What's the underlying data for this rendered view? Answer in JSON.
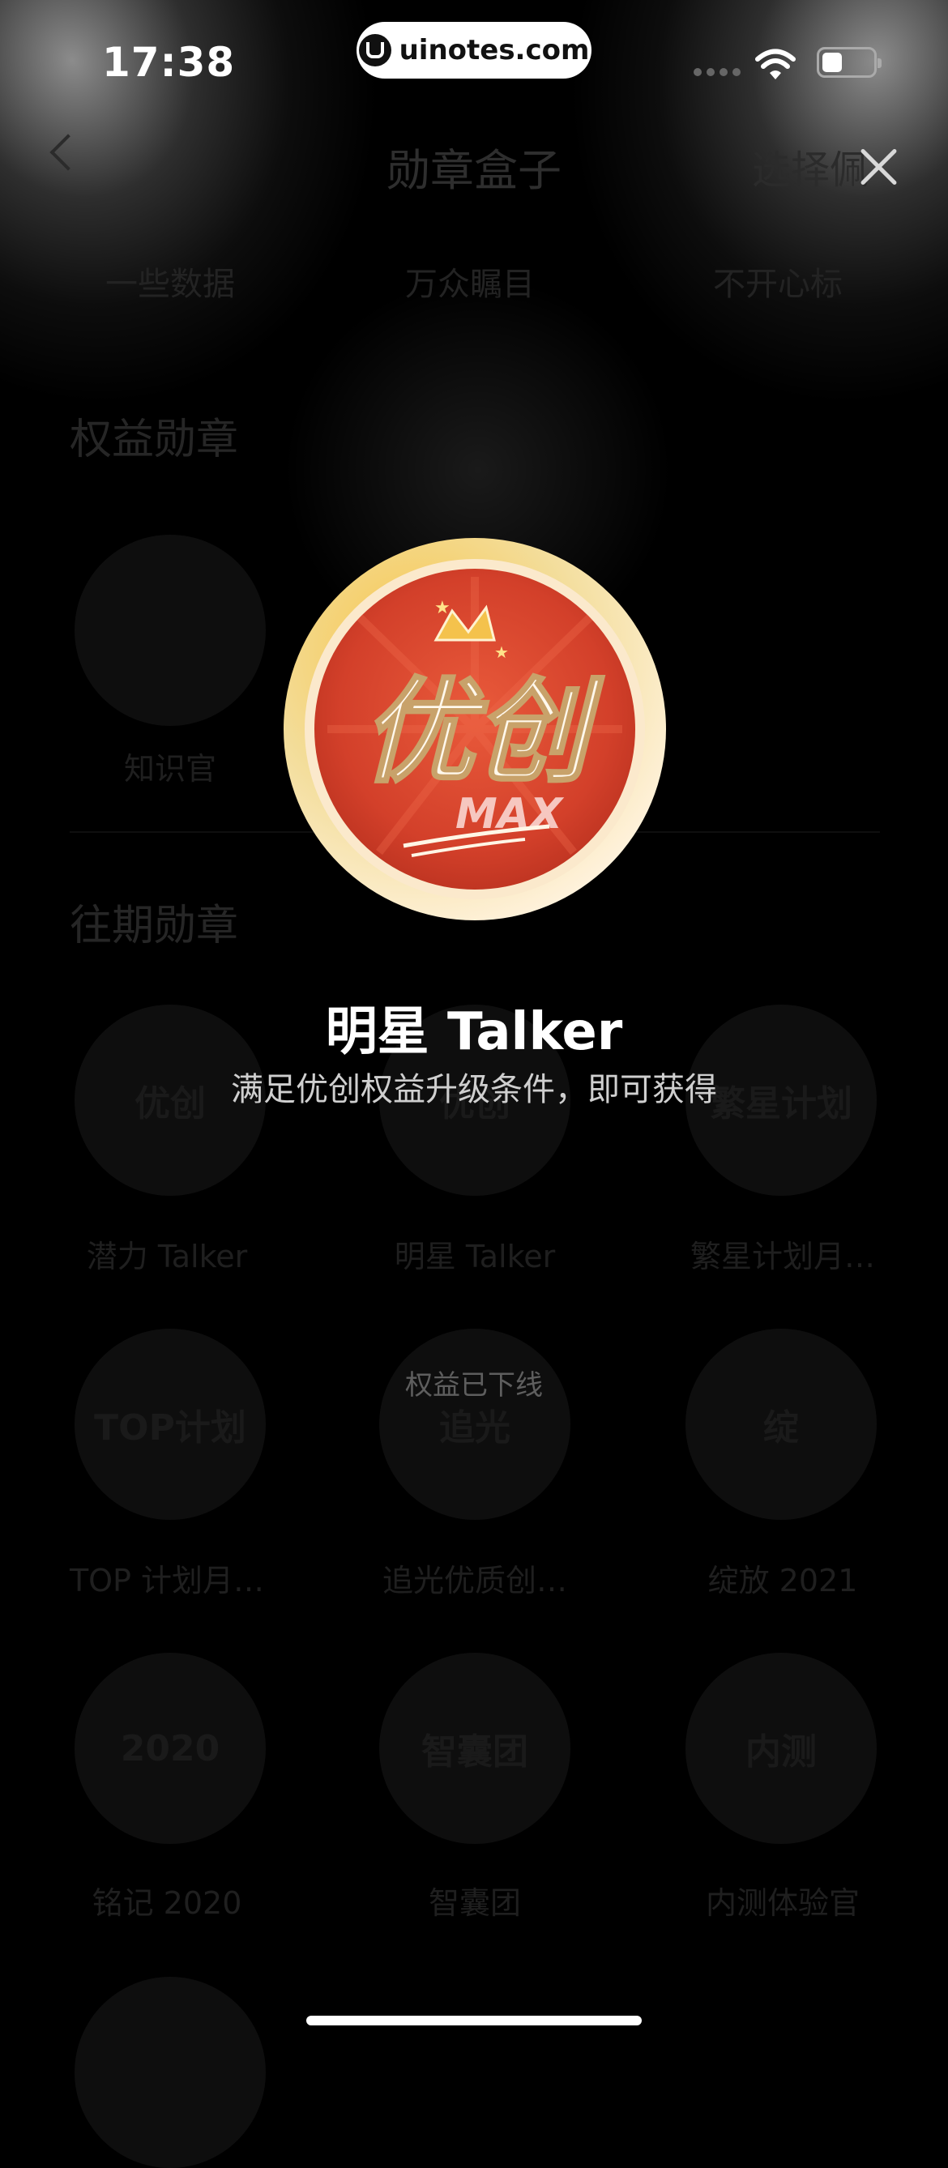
{
  "status_bar": {
    "time": "17:38",
    "url": "uinotes.com"
  },
  "background_page": {
    "title": "勋章盒子",
    "select_label": "选择佩",
    "tabs": [
      "一些数据",
      "万众瞩目",
      "不开心标"
    ],
    "section_benefits": "权益勋章",
    "benefit_badge_label": "知识官",
    "section_past": "往期勋章",
    "past_badges": [
      "潜力 Talker",
      "明星 Talker",
      "繁星计划月…",
      "TOP 计划月…",
      "追光优质创…",
      "绽放 2021",
      "铭记 2020",
      "智囊团",
      "内测体验官"
    ],
    "badge_art_text": [
      "优创",
      "优创",
      "繁星计划",
      "TOP计划",
      "追光",
      "绽",
      "2020",
      "智囊团",
      "内测"
    ]
  },
  "modal": {
    "badge_name": "明星 Talker",
    "badge_description": "满足优创权益升级条件，即可获得",
    "offline_note": "权益已下线",
    "medal_text_main": "优创",
    "medal_text_sub": "MAX",
    "colors": {
      "medal_red": "#d8412a",
      "medal_gold": "#f5c356",
      "ring": "#fbe7c4"
    }
  }
}
